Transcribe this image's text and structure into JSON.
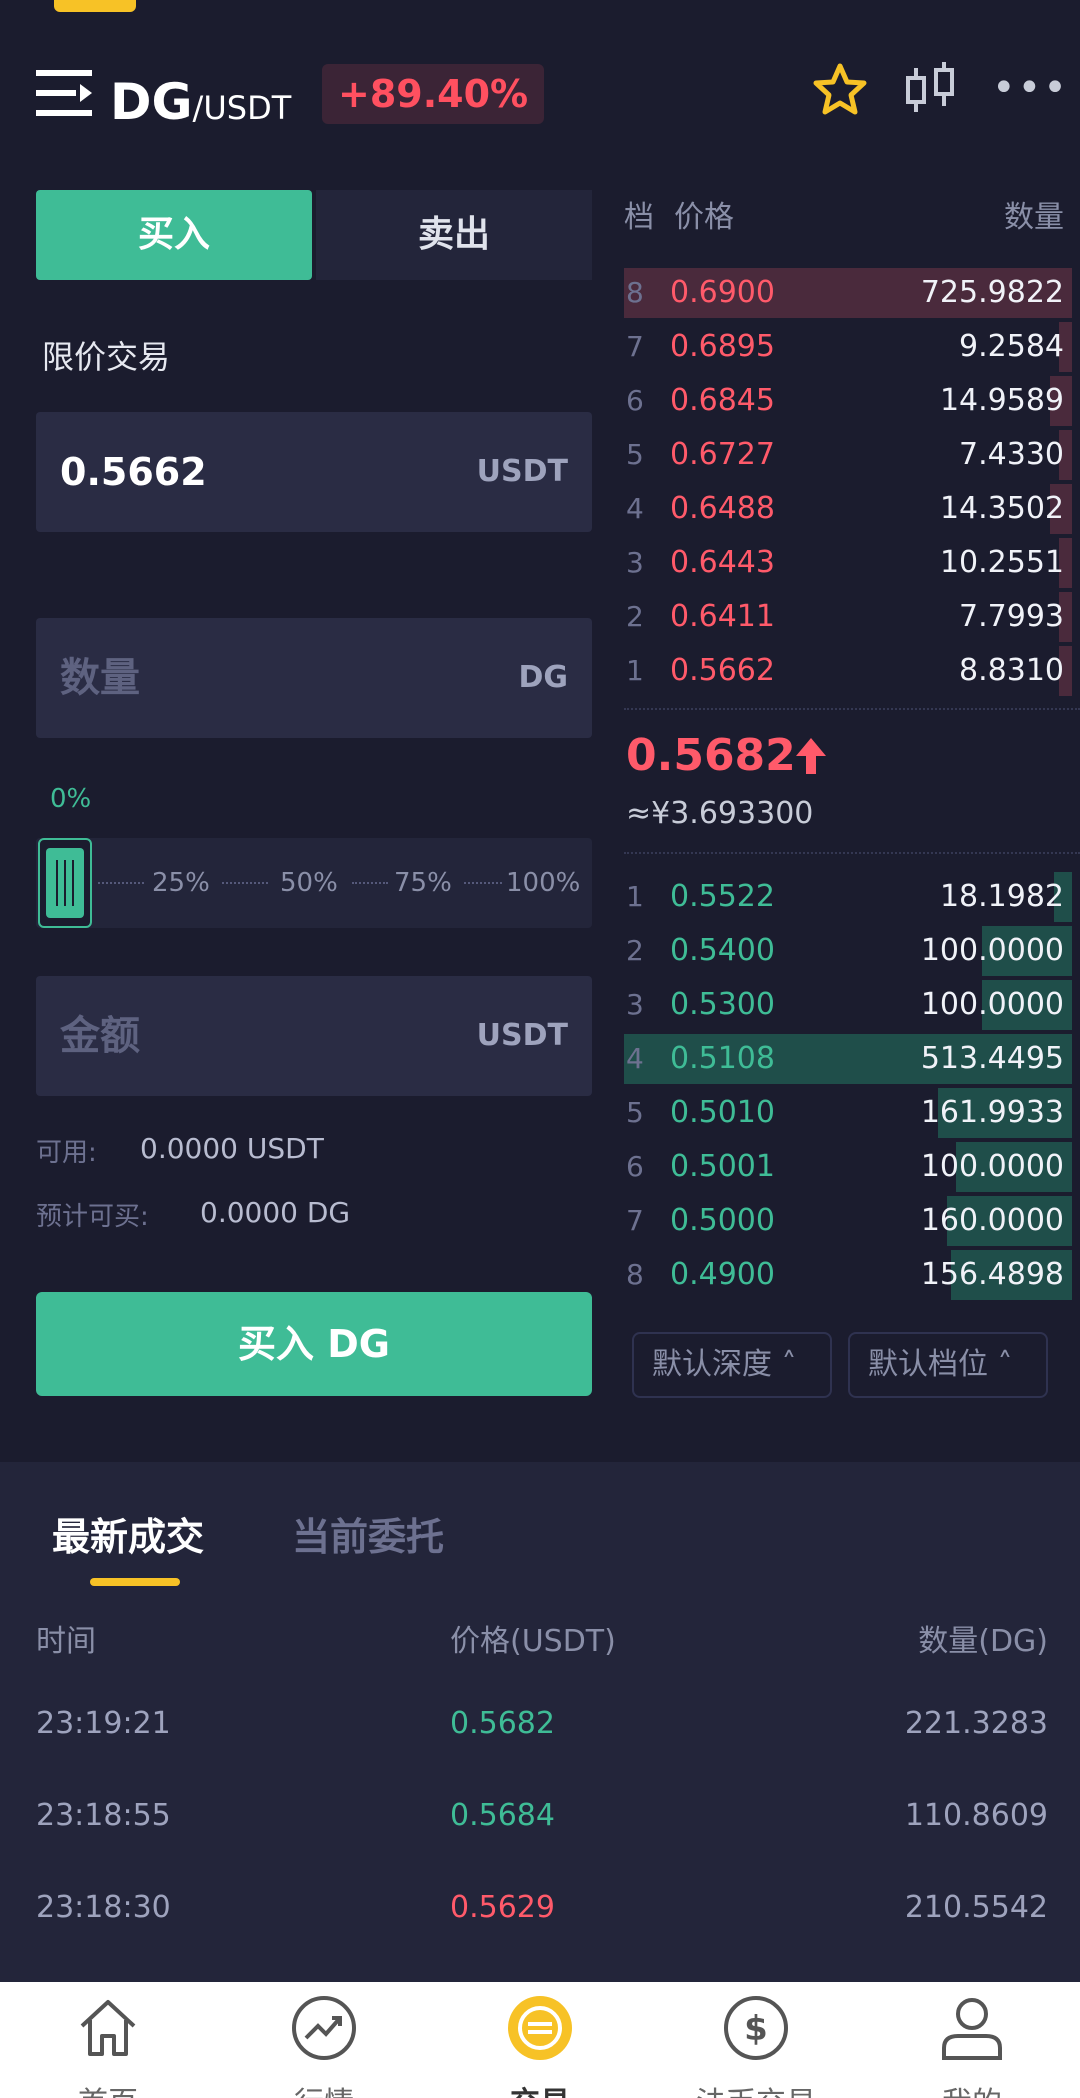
{
  "header": {
    "pair_base": "DG",
    "pair_quote": "/USDT",
    "change": "+89.40%"
  },
  "trade_tabs": {
    "buy": "买入",
    "sell": "卖出"
  },
  "order_type": "限价交易",
  "price_field": {
    "value": "0.5662",
    "unit": "USDT"
  },
  "qty_field": {
    "placeholder": "数量",
    "unit": "DG"
  },
  "slider": {
    "percent_label": "0%",
    "value_percent": 0,
    "marks": [
      "25%",
      "50%",
      "75%",
      "100%"
    ]
  },
  "amount_field": {
    "placeholder": "金额",
    "unit": "USDT"
  },
  "available": {
    "label": "可用:",
    "value": "0.0000  USDT"
  },
  "est_buy": {
    "label": "预计可买:",
    "value": "0.0000  DG"
  },
  "buy_button": "买入 DG",
  "orderbook": {
    "head_level": "档",
    "head_price": "价格",
    "head_qty": "数量",
    "asks": [
      {
        "level": "8",
        "price": "0.6900",
        "qty": "725.9822",
        "depth": 1.0
      },
      {
        "level": "7",
        "price": "0.6895",
        "qty": "9.2584",
        "depth": 0.03
      },
      {
        "level": "6",
        "price": "0.6845",
        "qty": "14.9589",
        "depth": 0.05
      },
      {
        "level": "5",
        "price": "0.6727",
        "qty": "7.4330",
        "depth": 0.03
      },
      {
        "level": "4",
        "price": "0.6488",
        "qty": "14.3502",
        "depth": 0.05
      },
      {
        "level": "3",
        "price": "0.6443",
        "qty": "10.2551",
        "depth": 0.03
      },
      {
        "level": "2",
        "price": "0.6411",
        "qty": "7.7993",
        "depth": 0.03
      },
      {
        "level": "1",
        "price": "0.5662",
        "qty": "8.8310",
        "depth": 0.03
      }
    ],
    "last_price": "0.5682",
    "last_price_cny": "≈¥3.693300",
    "bids": [
      {
        "level": "1",
        "price": "0.5522",
        "qty": "18.1982",
        "depth": 0.04
      },
      {
        "level": "2",
        "price": "0.5400",
        "qty": "100.0000",
        "depth": 0.2
      },
      {
        "level": "3",
        "price": "0.5300",
        "qty": "100.0000",
        "depth": 0.2
      },
      {
        "level": "4",
        "price": "0.5108",
        "qty": "513.4495",
        "depth": 1.0
      },
      {
        "level": "5",
        "price": "0.5010",
        "qty": "161.9933",
        "depth": 0.3
      },
      {
        "level": "6",
        "price": "0.5001",
        "qty": "100.0000",
        "depth": 0.26
      },
      {
        "level": "7",
        "price": "0.5000",
        "qty": "160.0000",
        "depth": 0.28
      },
      {
        "level": "8",
        "price": "0.4900",
        "qty": "156.4898",
        "depth": 0.27
      }
    ],
    "depth_select": "默认深度 ˄",
    "level_select": "默认档位 ˄"
  },
  "lower_tabs": {
    "latest": "最新成交",
    "current": "当前委托"
  },
  "trades_head": {
    "time": "时间",
    "price": "价格(USDT)",
    "qty": "数量(DG)"
  },
  "trades": [
    {
      "time": "23:19:21",
      "price": "0.5682",
      "qty": "221.3283",
      "side": "buy"
    },
    {
      "time": "23:18:55",
      "price": "0.5684",
      "qty": "110.8609",
      "side": "buy"
    },
    {
      "time": "23:18:30",
      "price": "0.5629",
      "qty": "210.5542",
      "side": "sell"
    }
  ],
  "nav": [
    {
      "label": "首页",
      "icon": "home-icon"
    },
    {
      "label": "行情",
      "icon": "market-icon"
    },
    {
      "label": "交易",
      "icon": "trade-icon"
    },
    {
      "label": "法币交易",
      "icon": "fiat-icon"
    },
    {
      "label": "我的",
      "icon": "profile-icon"
    }
  ],
  "colors": {
    "green": "#3fbc96",
    "red": "#ff5a6a",
    "accent": "#f7c226",
    "bg": "#1b1c2e"
  }
}
